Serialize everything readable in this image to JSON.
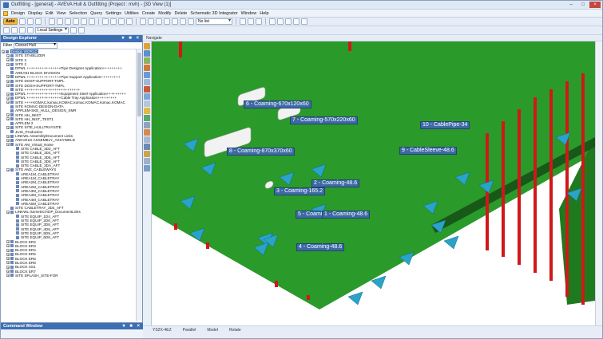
{
  "window": {
    "title": "Outfitting - [general] - AVEVA Hull & Outfitting (Project : mvh) - [3D View (1)]",
    "minimize": "–",
    "maximize": "□",
    "close": "×"
  },
  "menu": [
    "Design",
    "Display",
    "Edit",
    "View",
    "Selection",
    "Query",
    "Settings",
    "Utilities",
    "Create",
    "Modify",
    "Delete",
    "Schematic 3D Integrator",
    "Window",
    "Help"
  ],
  "toolbar": {
    "auto_label": "Auto",
    "combo_rootfolder": "No list",
    "combo_local": "Local Settings"
  },
  "explorer": {
    "title": "Design Explorer",
    "head_buttons": "▾ ■ ×",
    "filter_label": "Filter",
    "filter_value": "Consol Hull",
    "items": [
      "Design WORLD",
      "SITE STABILIZER",
      "SITE 2",
      "SITE 2",
      "DPWL ++++++++++++++++Pipe Designer Application+++++++++",
      "AREA91 BLOCK DIVISION",
      "DPWL ++++++++++++++++Pipe Support Application+++++++++",
      "SITE DOSP-SUPPORT-TMPL",
      "SITE DOSH-SUPPORT-TMPL",
      "SITE ++++++++++++++++++++++++++",
      "DPWL ++++++++++++++++Equipment Steel Application+++++++++",
      "DPWL ++++++++++++++++Cable Tray Application+++++++++",
      "SITE ++++KOMAC.komac.KOMAC.komac.KOMAC.komac.KOMAC",
      "SITE KOMAC-DESIGN-DATA",
      "APPLEM-SKE_HULL_DESIGN_SMR",
      "SITE HH_INIST",
      "SITE HH_INST_TEST1",
      "APPLEM 2",
      "SITE SITE_HULLTRAYSITE",
      "JUIS_Production",
      "LINKWL Assembly/Document Links",
      "ANKVELD ASSEMBLY_ASSYWELD",
      "SITE AM_Virtual_Noise",
      "SITE CABLE_3D2_AFT",
      "SITE CABLE_3D4_AFT",
      "SITE CABLE_3D6_AFT",
      "SITE CABLE_3D8_AFT",
      "SITE CABLE_3DA_AFT",
      "SITE AM2_CABLEWAYS",
      "AREA1M_CABLETRAY",
      "AREA1M_CABLETRAY",
      "AREA2M_CABLETRAY",
      "AREA2M_CABLETRAY",
      "AREA3M_CABLETRAY",
      "AREA3M_CABLETRAY",
      "AREA4M_CABLETRAY",
      "AREA5M_CABLETRAY",
      "SITE CABLETRAY_3D4_AFT",
      "LINKWL Isometric/ADP_DocumentLinks",
      "SITE EQUIP_1D4_AFT",
      "SITE EQUIP_2D6_AFT",
      "SITE EQUIP_3D8_AFT",
      "SITE EQUIP_4D6_AFT",
      "SITE EQUIP_5D8_AFT",
      "SITE EQUIP_6D8_AFT",
      "BLOCK ER2",
      "BLOCK ER3",
      "BLOCK ER4",
      "BLOCK ER5",
      "BLOCK ER6",
      "BLOCK ER8",
      "BLOCK SS1",
      "BLOCK ER7",
      "SITE SPLASH_SITE-FOR"
    ]
  },
  "command_window": {
    "title": "Command Window",
    "head_buttons": "▾ ■ ×"
  },
  "view": {
    "header": "Navigate",
    "status": [
      "YS2X-4EZ",
      "Parallel",
      "Model",
      "Rotate"
    ]
  },
  "annotations": [
    "6 - Coaming-670x120x60",
    "7 - Coaming-570x220x60",
    "8 - Coaming-870x370x60",
    "10 - CablePipe-34",
    "9 - CableSleeve-48.6",
    "2 - Coaming-48.6",
    "3 - Coaming-165.2",
    "5 - Coaming-48.6",
    "1 - Coaming-48.6",
    "4 - Coaming-48.6"
  ],
  "colors": {
    "deck": "#2a9a2a",
    "bulkhead": "#1f6a1f",
    "pipe": "#d01818",
    "bracket": "#2aa3c8",
    "tag": "#3d6aa6"
  }
}
